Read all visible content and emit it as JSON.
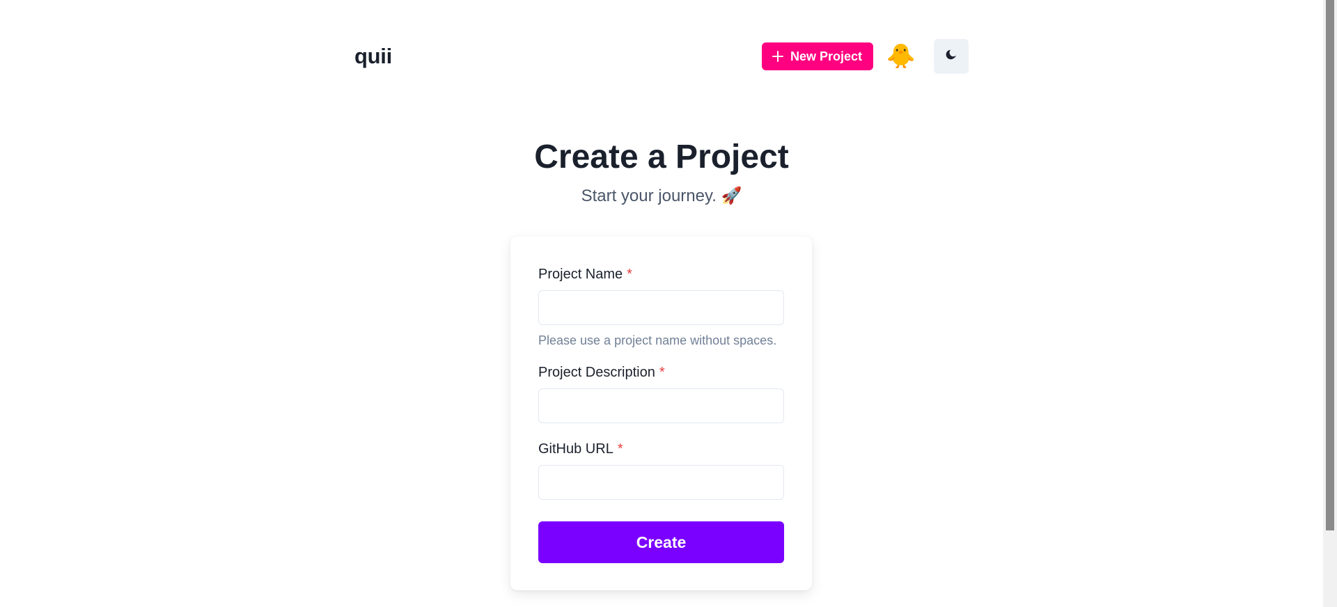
{
  "header": {
    "logo": "quii",
    "new_project_label": "New Project",
    "avatar_emoji": "🐥",
    "theme_icon": "moon-icon"
  },
  "main": {
    "title": "Create a Project",
    "subtitle": "Start your journey. 🚀"
  },
  "form": {
    "required_marker": "*",
    "fields": [
      {
        "label": "Project Name",
        "value": "",
        "placeholder": "",
        "helper": "Please use a project name without spaces."
      },
      {
        "label": "Project Description",
        "value": "",
        "placeholder": ""
      },
      {
        "label": "GitHub URL",
        "value": "",
        "placeholder": ""
      }
    ],
    "submit_label": "Create"
  },
  "colors": {
    "new_project_bg": "#ff0080",
    "create_bg": "#7a00ff",
    "required": "#e53e3e",
    "theme_toggle_bg": "#edf2f7"
  }
}
